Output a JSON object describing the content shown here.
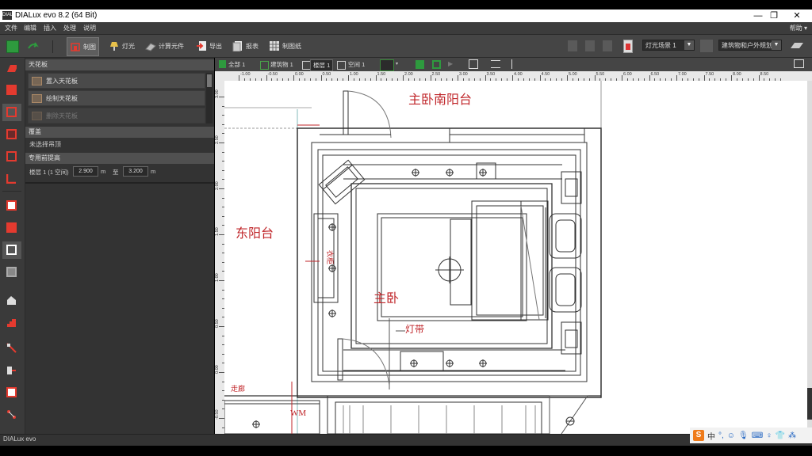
{
  "window": {
    "title": "DIALux evo 8.2  (64 Bit)",
    "icon_text": "DIAL",
    "controls": [
      "—",
      "❐",
      "✕"
    ]
  },
  "menu": {
    "items": [
      "文件",
      "编辑",
      "插入",
      "处理",
      "说明"
    ],
    "help": "帮助 ▾"
  },
  "toolbar": {
    "buttons": [
      "制图",
      "灯光",
      "计算元件",
      "导出",
      "报表",
      "制图纸"
    ],
    "scene_select": "灯光场景 1",
    "view_select": "建筑物和户外规划"
  },
  "panel": {
    "section_ceiling": "天花板",
    "item_insert_ceiling": "置入天花板",
    "item_draw_ceiling": "绘制天花板",
    "item_dim": "删除天花板",
    "section_cover": "覆盖",
    "cover_text": "未选择吊顶",
    "section_height": "专用前提高",
    "floor_label": "楼层 1 (1 空间)",
    "field1_value": "2.900",
    "field1_unit": "m",
    "sep": "至",
    "field2_value": "3.200",
    "field2_unit": "m"
  },
  "viewtabs": [
    "全部 1",
    "建筑物 1",
    "楼层 1",
    "空间 1"
  ],
  "ruler": {
    "top_labels": [
      "-1.00",
      "-0.50",
      "0.00",
      "0.50",
      "1.00",
      "1.50",
      "2.00",
      "2.50",
      "3.00",
      "3.50",
      "4.00",
      "4.50",
      "5.00",
      "5.50",
      "6.00",
      "6.50",
      "7.00",
      "7.50",
      "8.00",
      "8.50"
    ],
    "left_labels": [
      "3.00",
      "2.50",
      "2.00",
      "1.50",
      "1.00",
      "0.50",
      "0.00",
      "-0.50"
    ]
  },
  "drawing": {
    "label_south_balcony": "主卧南阳台",
    "label_east_balcony": "东阳台",
    "label_master": "主卧",
    "label_cabinet": "衣柜",
    "label_lightstrip": "灯带",
    "label_wm": "WM",
    "label_small": "走廊"
  },
  "statusbar": {
    "text": "DIALux evo"
  },
  "ime": {
    "logo": "S",
    "mode": "中",
    "icons": [
      "°,",
      "☺",
      "🎙",
      "⌨",
      "♀",
      "👕",
      "⁂"
    ]
  },
  "colors": {
    "accent_orange": "#ef7b1a",
    "label_red": "#c0262a",
    "ui_dark": "#454545"
  }
}
